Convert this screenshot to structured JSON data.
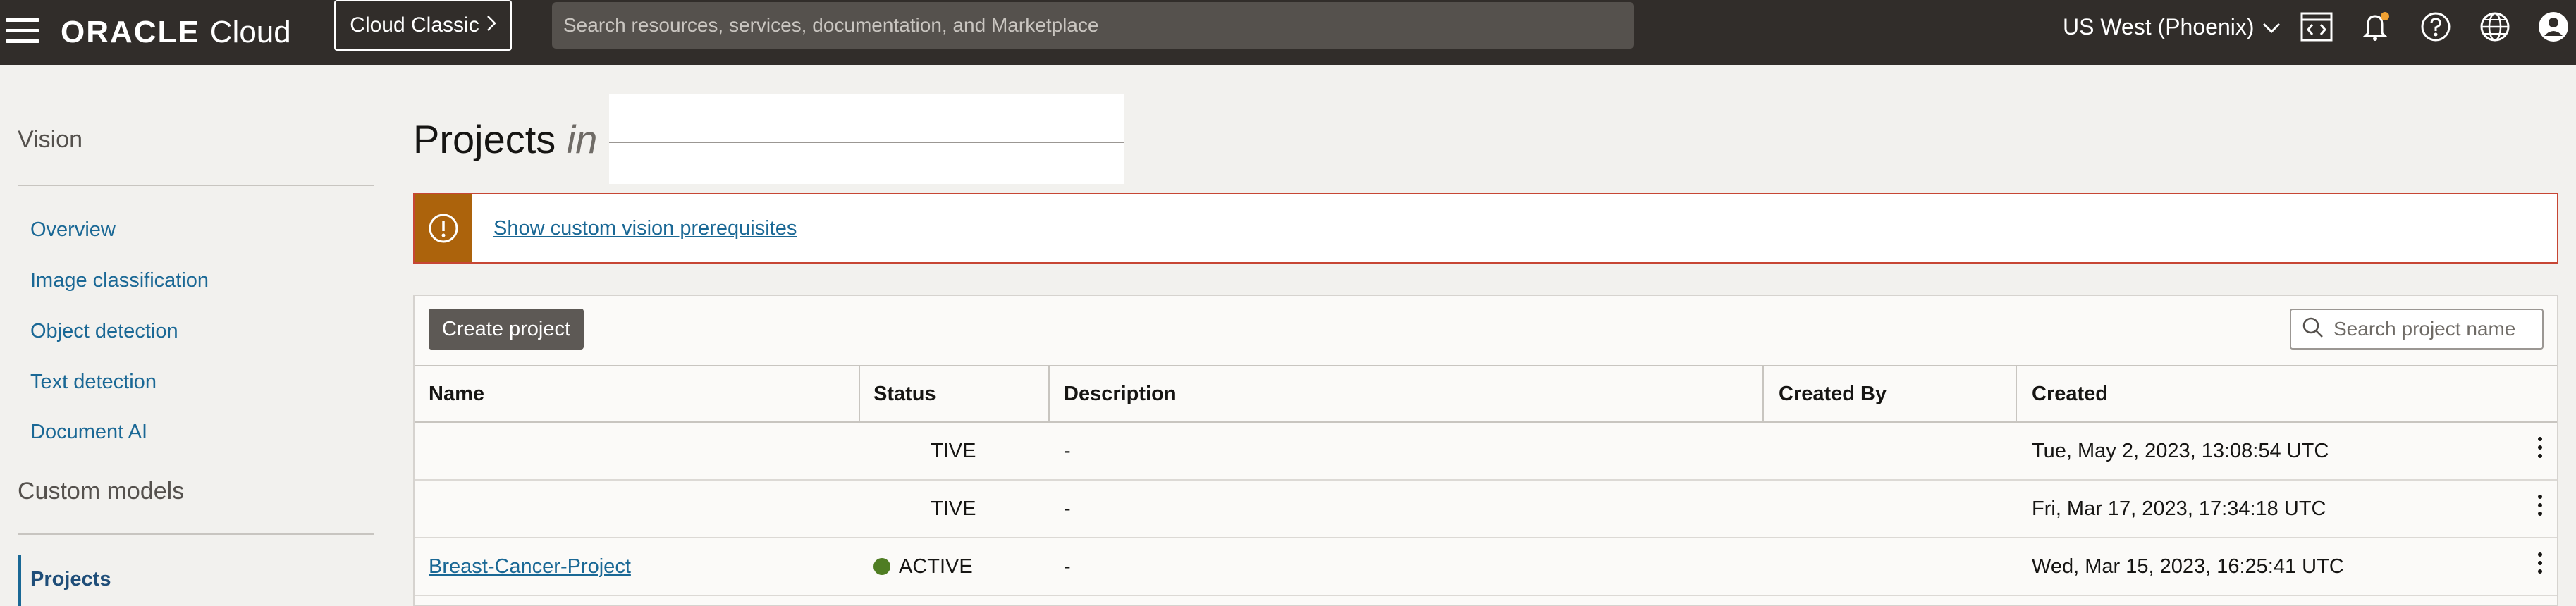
{
  "topbar": {
    "brand": "ORACLE",
    "product": "Cloud",
    "classic_label": "Cloud Classic",
    "search_placeholder": "Search resources, services, documentation, and Marketplace",
    "region": "US West (Phoenix)",
    "icons": [
      "menu-icon",
      "code-editor-icon",
      "bell-icon",
      "help-icon",
      "globe-icon",
      "user-avatar-icon"
    ]
  },
  "nav": {
    "title": "Vision",
    "items": [
      "Overview",
      "Image classification",
      "Object detection",
      "Text detection",
      "Document AI"
    ],
    "section": "Custom models",
    "active_item": "Projects"
  },
  "page": {
    "title": "Projects",
    "title_in": "in",
    "alert_link": "Show custom vision prerequisites",
    "create_button": "Create project",
    "search_placeholder": "Search project name"
  },
  "table": {
    "columns": [
      "Name",
      "Status",
      "Description",
      "Created By",
      "Created"
    ],
    "rows": [
      {
        "name": "",
        "status": "TIVE",
        "description": "-",
        "created_by": "",
        "created": "Tue, May 2, 2023, 13:08:54 UTC"
      },
      {
        "name": "",
        "status": "TIVE",
        "description": "-",
        "created_by": "",
        "created": "Fri, Mar 17, 2023, 17:34:18 UTC"
      },
      {
        "name": "Breast-Cancer-Project",
        "status": "ACTIVE",
        "description": "-",
        "created_by": "",
        "created": "Wed, Mar 15, 2023, 16:25:41 UTC"
      }
    ]
  },
  "colors": {
    "topbar": "#312d2a",
    "link": "#1a6895",
    "alert_accent": "#ac630c",
    "alert_border": "#c74634",
    "status_active": "#4f7d23"
  }
}
